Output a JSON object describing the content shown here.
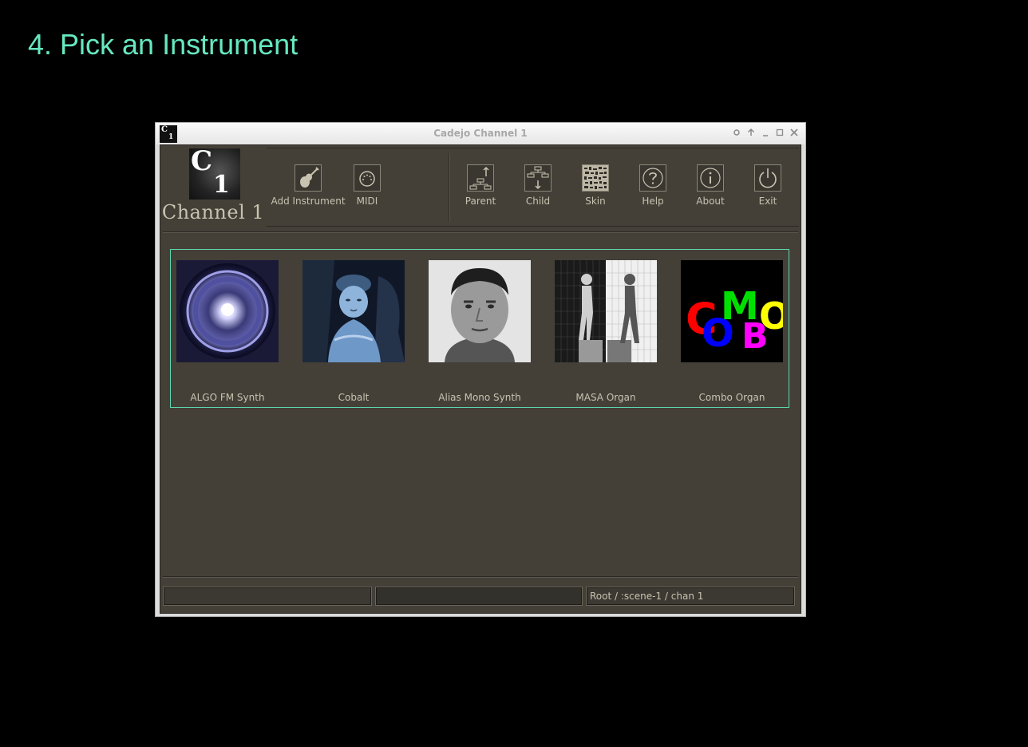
{
  "slide": {
    "title": "4. Pick an Instrument"
  },
  "window": {
    "title": "Cadejo Channel 1",
    "icon_text": {
      "c": "C",
      "n": "1"
    },
    "buttons": [
      "pin-icon",
      "up-icon",
      "minimize-icon",
      "maximize-icon",
      "close-icon"
    ]
  },
  "header": {
    "logo": {
      "c": "C",
      "n": "1"
    },
    "label": "Channel 1"
  },
  "toolbar": {
    "add_instrument": "Add Instrument",
    "midi": "MIDI",
    "parent": "Parent",
    "child": "Child",
    "skin": "Skin",
    "help": "Help",
    "about": "About",
    "exit": "Exit"
  },
  "instruments": [
    {
      "name": "ALGO FM Synth",
      "icon": "glowing-orb-image"
    },
    {
      "name": "Cobalt",
      "icon": "figurine-image"
    },
    {
      "name": "Alias Mono Synth",
      "icon": "face-portrait-image"
    },
    {
      "name": "MASA Organ",
      "icon": "walking-figures-image"
    },
    {
      "name": "Combo Organ",
      "icon": "combo-logo-image",
      "logo_text": "COMBO"
    }
  ],
  "status": {
    "field1": "",
    "field2": "",
    "path": "Root / :scene-1 / chan 1"
  },
  "colors": {
    "title": "#66e8c0",
    "panel_bg": "#444038",
    "selection_border": "#5fd8b0",
    "text": "#c8c2b0"
  }
}
